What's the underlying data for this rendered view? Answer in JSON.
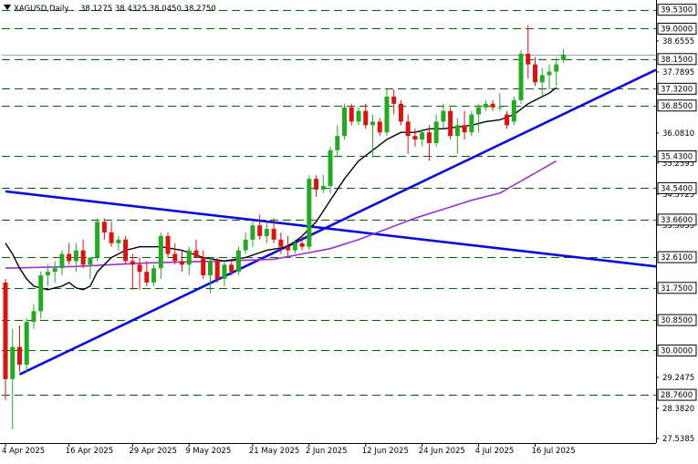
{
  "header": {
    "symbol": "XAGUSD,Daily",
    "ohlc": "38.1275 38.4325 38.0450 38.2750"
  },
  "colors": {
    "bull": "#22aa22",
    "bear": "#dd1111",
    "grid": "#006600",
    "trend": "#0a0adc",
    "ma_fast": "#000000",
    "ma_slow": "#9933cc",
    "label_text": "#000000",
    "tag_bg": "#ffffff"
  },
  "chart_data": {
    "type": "candlestick",
    "ylim": [
      27.5385,
      39.7
    ],
    "x_axis_labels": [
      {
        "i": 0,
        "label": "4 Apr 2025"
      },
      {
        "i": 9,
        "label": "16 Apr 2025"
      },
      {
        "i": 18,
        "label": "29 Apr 2025"
      },
      {
        "i": 26,
        "label": "9 May 2025"
      },
      {
        "i": 35,
        "label": "21 May 2025"
      },
      {
        "i": 43,
        "label": "2 Jun 2025"
      },
      {
        "i": 51,
        "label": "12 Jun 2025"
      },
      {
        "i": 59,
        "label": "24 Jun 2025"
      },
      {
        "i": 67,
        "label": "4 Jul 2025"
      },
      {
        "i": 75,
        "label": "16 Jul 2025"
      }
    ],
    "price_axis_labels": [
      "38.6555",
      "37.7895",
      "36.0810",
      "35.2395",
      "34.3725",
      "33.5055",
      "29.2475",
      "28.3820",
      "27.5385"
    ],
    "levels": [
      {
        "value": 39.53,
        "label": "39.5300"
      },
      {
        "value": 39.0,
        "label": "39.0000"
      },
      {
        "value": 38.15,
        "label": "38.1500"
      },
      {
        "value": 37.32,
        "label": "37.3200"
      },
      {
        "value": 36.85,
        "label": "36.8500"
      },
      {
        "value": 35.43,
        "label": "35.4300"
      },
      {
        "value": 34.54,
        "label": "34.5400"
      },
      {
        "value": 33.66,
        "label": "33.6600"
      },
      {
        "value": 32.61,
        "label": "32.6100"
      },
      {
        "value": 31.75,
        "label": "31.7500"
      },
      {
        "value": 30.85,
        "label": "30.8500"
      },
      {
        "value": 30.0,
        "label": "30.0000"
      },
      {
        "value": 28.76,
        "label": "28.7600"
      }
    ],
    "current_price": 38.275,
    "candles": [
      {
        "o": 31.9,
        "h": 32.0,
        "l": 28.6,
        "c": 29.2
      },
      {
        "o": 29.2,
        "h": 30.6,
        "l": 27.8,
        "c": 30.1
      },
      {
        "o": 30.1,
        "h": 30.7,
        "l": 29.4,
        "c": 29.6
      },
      {
        "o": 29.6,
        "h": 30.9,
        "l": 29.4,
        "c": 30.8
      },
      {
        "o": 30.8,
        "h": 31.3,
        "l": 30.6,
        "c": 31.1
      },
      {
        "o": 31.1,
        "h": 32.2,
        "l": 30.9,
        "c": 32.1
      },
      {
        "o": 32.1,
        "h": 32.4,
        "l": 31.8,
        "c": 32.2
      },
      {
        "o": 32.2,
        "h": 32.5,
        "l": 31.9,
        "c": 32.3
      },
      {
        "o": 32.3,
        "h": 32.8,
        "l": 32.1,
        "c": 32.7
      },
      {
        "o": 32.7,
        "h": 33.0,
        "l": 32.4,
        "c": 32.5
      },
      {
        "o": 32.5,
        "h": 33.0,
        "l": 32.2,
        "c": 32.8
      },
      {
        "o": 32.8,
        "h": 33.1,
        "l": 32.3,
        "c": 32.4
      },
      {
        "o": 32.4,
        "h": 32.6,
        "l": 32.0,
        "c": 32.6
      },
      {
        "o": 32.6,
        "h": 33.7,
        "l": 32.5,
        "c": 33.6
      },
      {
        "o": 33.6,
        "h": 33.7,
        "l": 33.1,
        "c": 33.3
      },
      {
        "o": 33.3,
        "h": 33.6,
        "l": 32.9,
        "c": 33.0
      },
      {
        "o": 33.0,
        "h": 33.2,
        "l": 32.8,
        "c": 33.1
      },
      {
        "o": 33.1,
        "h": 33.2,
        "l": 32.4,
        "c": 32.5
      },
      {
        "o": 32.5,
        "h": 32.7,
        "l": 31.7,
        "c": 32.4
      },
      {
        "o": 32.4,
        "h": 32.6,
        "l": 31.7,
        "c": 32.2
      },
      {
        "o": 32.2,
        "h": 32.5,
        "l": 31.8,
        "c": 31.9
      },
      {
        "o": 31.9,
        "h": 32.4,
        "l": 31.8,
        "c": 32.3
      },
      {
        "o": 32.3,
        "h": 33.3,
        "l": 32.0,
        "c": 33.2
      },
      {
        "o": 33.2,
        "h": 33.3,
        "l": 32.6,
        "c": 32.7
      },
      {
        "o": 32.7,
        "h": 33.0,
        "l": 32.4,
        "c": 32.5
      },
      {
        "o": 32.5,
        "h": 32.8,
        "l": 32.2,
        "c": 32.4
      },
      {
        "o": 32.4,
        "h": 32.9,
        "l": 32.1,
        "c": 32.8
      },
      {
        "o": 32.8,
        "h": 33.1,
        "l": 32.6,
        "c": 32.6
      },
      {
        "o": 32.6,
        "h": 32.8,
        "l": 32.0,
        "c": 32.1
      },
      {
        "o": 32.1,
        "h": 32.6,
        "l": 31.6,
        "c": 32.5
      },
      {
        "o": 32.5,
        "h": 32.6,
        "l": 31.9,
        "c": 32.0
      },
      {
        "o": 32.0,
        "h": 32.5,
        "l": 31.8,
        "c": 32.4
      },
      {
        "o": 32.4,
        "h": 32.5,
        "l": 32.1,
        "c": 32.2
      },
      {
        "o": 32.2,
        "h": 32.9,
        "l": 32.1,
        "c": 32.8
      },
      {
        "o": 32.8,
        "h": 33.3,
        "l": 32.7,
        "c": 33.1
      },
      {
        "o": 33.1,
        "h": 33.6,
        "l": 32.9,
        "c": 33.5
      },
      {
        "o": 33.5,
        "h": 33.8,
        "l": 33.1,
        "c": 33.2
      },
      {
        "o": 33.2,
        "h": 33.6,
        "l": 33.0,
        "c": 33.4
      },
      {
        "o": 33.4,
        "h": 33.7,
        "l": 33.0,
        "c": 33.1
      },
      {
        "o": 33.1,
        "h": 33.3,
        "l": 32.7,
        "c": 32.9
      },
      {
        "o": 32.9,
        "h": 33.2,
        "l": 32.6,
        "c": 32.8
      },
      {
        "o": 32.8,
        "h": 33.1,
        "l": 32.7,
        "c": 33.0
      },
      {
        "o": 33.0,
        "h": 33.2,
        "l": 32.8,
        "c": 32.9
      },
      {
        "o": 32.9,
        "h": 34.9,
        "l": 32.8,
        "c": 34.8
      },
      {
        "o": 34.8,
        "h": 34.9,
        "l": 34.3,
        "c": 34.5
      },
      {
        "o": 34.5,
        "h": 34.9,
        "l": 34.4,
        "c": 34.6
      },
      {
        "o": 34.6,
        "h": 35.7,
        "l": 34.4,
        "c": 35.6
      },
      {
        "o": 35.6,
        "h": 36.3,
        "l": 35.4,
        "c": 36.0
      },
      {
        "o": 36.0,
        "h": 36.9,
        "l": 35.9,
        "c": 36.8
      },
      {
        "o": 36.8,
        "h": 36.9,
        "l": 36.3,
        "c": 36.4
      },
      {
        "o": 36.4,
        "h": 36.8,
        "l": 36.3,
        "c": 36.7
      },
      {
        "o": 36.7,
        "h": 36.9,
        "l": 36.2,
        "c": 36.3
      },
      {
        "o": 36.3,
        "h": 36.6,
        "l": 35.4,
        "c": 36.4
      },
      {
        "o": 36.4,
        "h": 36.5,
        "l": 36.0,
        "c": 36.1
      },
      {
        "o": 36.1,
        "h": 37.3,
        "l": 36.0,
        "c": 37.1
      },
      {
        "o": 37.1,
        "h": 37.3,
        "l": 36.6,
        "c": 36.9
      },
      {
        "o": 36.9,
        "h": 37.0,
        "l": 36.3,
        "c": 36.4
      },
      {
        "o": 36.4,
        "h": 36.6,
        "l": 35.5,
        "c": 36.0
      },
      {
        "o": 36.0,
        "h": 36.2,
        "l": 35.7,
        "c": 35.9
      },
      {
        "o": 35.9,
        "h": 36.2,
        "l": 35.7,
        "c": 36.1
      },
      {
        "o": 36.1,
        "h": 36.3,
        "l": 35.3,
        "c": 35.8
      },
      {
        "o": 35.8,
        "h": 36.6,
        "l": 35.7,
        "c": 36.4
      },
      {
        "o": 36.4,
        "h": 36.9,
        "l": 36.2,
        "c": 36.7
      },
      {
        "o": 36.7,
        "h": 36.8,
        "l": 35.9,
        "c": 36.0
      },
      {
        "o": 36.0,
        "h": 36.5,
        "l": 35.5,
        "c": 36.3
      },
      {
        "o": 36.3,
        "h": 36.7,
        "l": 35.9,
        "c": 36.1
      },
      {
        "o": 36.1,
        "h": 36.7,
        "l": 36.0,
        "c": 36.6
      },
      {
        "o": 36.6,
        "h": 36.9,
        "l": 36.1,
        "c": 36.8
      },
      {
        "o": 36.8,
        "h": 37.0,
        "l": 36.7,
        "c": 36.9
      },
      {
        "o": 36.9,
        "h": 37.0,
        "l": 36.7,
        "c": 36.8
      },
      {
        "o": 36.8,
        "h": 37.2,
        "l": 36.7,
        "c": 36.8
      },
      {
        "o": 36.6,
        "h": 36.7,
        "l": 36.2,
        "c": 36.3
      },
      {
        "o": 36.4,
        "h": 37.1,
        "l": 36.3,
        "c": 37.0
      },
      {
        "o": 37.0,
        "h": 38.4,
        "l": 36.9,
        "c": 38.3
      },
      {
        "o": 38.3,
        "h": 39.1,
        "l": 37.6,
        "c": 38.0
      },
      {
        "o": 38.0,
        "h": 38.2,
        "l": 37.4,
        "c": 37.5
      },
      {
        "o": 37.5,
        "h": 37.9,
        "l": 37.1,
        "c": 37.7
      },
      {
        "o": 37.7,
        "h": 38.0,
        "l": 37.3,
        "c": 37.8
      },
      {
        "o": 37.8,
        "h": 38.2,
        "l": 37.4,
        "c": 38.0
      },
      {
        "o": 38.1275,
        "h": 38.4325,
        "l": 38.045,
        "c": 38.275
      }
    ],
    "ma_fast": [
      {
        "i": 0,
        "v": 33.0
      },
      {
        "i": 1,
        "v": 32.7
      },
      {
        "i": 2,
        "v": 32.3
      },
      {
        "i": 3,
        "v": 32.0
      },
      {
        "i": 4,
        "v": 31.8
      },
      {
        "i": 6,
        "v": 31.7
      },
      {
        "i": 8,
        "v": 31.8
      },
      {
        "i": 9,
        "v": 31.9
      },
      {
        "i": 10,
        "v": 31.75
      },
      {
        "i": 11,
        "v": 31.7
      },
      {
        "i": 12,
        "v": 31.8
      },
      {
        "i": 13,
        "v": 32.2
      },
      {
        "i": 15,
        "v": 32.6
      },
      {
        "i": 17,
        "v": 32.8
      },
      {
        "i": 19,
        "v": 32.9
      },
      {
        "i": 22,
        "v": 32.9
      },
      {
        "i": 25,
        "v": 32.8
      },
      {
        "i": 28,
        "v": 32.6
      },
      {
        "i": 31,
        "v": 32.5
      },
      {
        "i": 34,
        "v": 32.6
      },
      {
        "i": 37,
        "v": 32.8
      },
      {
        "i": 40,
        "v": 32.9
      },
      {
        "i": 42,
        "v": 33.2
      },
      {
        "i": 44,
        "v": 33.6
      },
      {
        "i": 46,
        "v": 34.2
      },
      {
        "i": 48,
        "v": 34.8
      },
      {
        "i": 50,
        "v": 35.3
      },
      {
        "i": 52,
        "v": 35.6
      },
      {
        "i": 54,
        "v": 35.9
      },
      {
        "i": 56,
        "v": 36.1
      },
      {
        "i": 58,
        "v": 36.1
      },
      {
        "i": 60,
        "v": 36.2
      },
      {
        "i": 62,
        "v": 36.2
      },
      {
        "i": 64,
        "v": 36.25
      },
      {
        "i": 66,
        "v": 36.3
      },
      {
        "i": 68,
        "v": 36.4
      },
      {
        "i": 70,
        "v": 36.45
      },
      {
        "i": 72,
        "v": 36.6
      },
      {
        "i": 74,
        "v": 36.9
      },
      {
        "i": 76,
        "v": 37.1
      },
      {
        "i": 77,
        "v": 37.2
      },
      {
        "i": 78,
        "v": 37.35
      }
    ],
    "ma_slow": [
      {
        "i": 0,
        "v": 32.3
      },
      {
        "i": 10,
        "v": 32.35
      },
      {
        "i": 20,
        "v": 32.45
      },
      {
        "i": 30,
        "v": 32.5
      },
      {
        "i": 38,
        "v": 32.55
      },
      {
        "i": 42,
        "v": 32.7
      },
      {
        "i": 46,
        "v": 32.85
      },
      {
        "i": 50,
        "v": 33.1
      },
      {
        "i": 54,
        "v": 33.4
      },
      {
        "i": 58,
        "v": 33.7
      },
      {
        "i": 62,
        "v": 33.95
      },
      {
        "i": 66,
        "v": 34.2
      },
      {
        "i": 70,
        "v": 34.4
      },
      {
        "i": 74,
        "v": 34.85
      },
      {
        "i": 78,
        "v": 35.3
      }
    ],
    "trendlines": [
      {
        "name": "rising support",
        "from": {
          "i": 2,
          "v": 29.33
        },
        "to": {
          "i": 95,
          "v": 37.85
        }
      },
      {
        "name": "falling line",
        "from": {
          "i": 0,
          "v": 34.45
        },
        "to": {
          "i": 95,
          "v": 32.35
        }
      }
    ]
  }
}
